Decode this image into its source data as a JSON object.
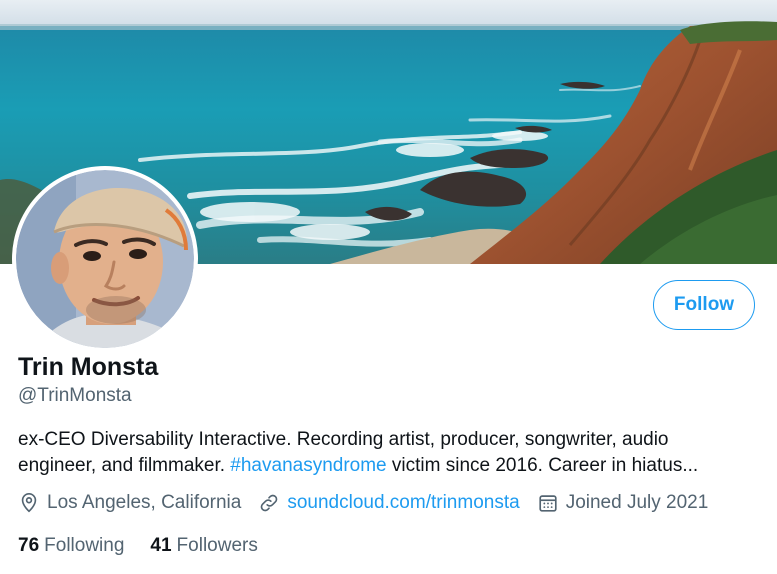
{
  "profile": {
    "display_name": "Trin Monsta",
    "handle": "@TrinMonsta",
    "follow_label": "Follow",
    "bio_part1": "ex-CEO Diversability Interactive. Recording artist, producer, songwriter, audio engineer, and filmmaker. ",
    "bio_hashtag": "#havanasyndrome",
    "bio_part2": " victim since 2016. Career in hiatus...",
    "location": "Los Angeles, California",
    "website": "soundcloud.com/trinmonsta",
    "joined": "Joined July 2021",
    "following_count": "76",
    "following_label": "Following",
    "followers_count": "41",
    "followers_label": "Followers"
  },
  "icons": {
    "location": "location-pin-icon",
    "link": "link-icon",
    "calendar": "calendar-icon"
  },
  "colors": {
    "accent": "#1d9bf0",
    "text_primary": "#0f1419",
    "text_secondary": "#536471"
  }
}
